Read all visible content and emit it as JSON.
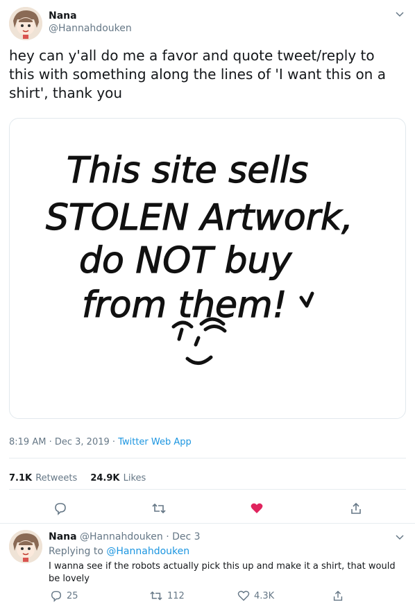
{
  "main_tweet": {
    "author_name": "Nana",
    "author_handle": "@Hannahdouken",
    "text": "hey can y'all do me a favor and quote tweet/reply to this with something along the lines of 'I want this on a shirt', thank you",
    "image_text": [
      "This site sells",
      "STOLEN Artwork,",
      "do NOT buy",
      "from them!"
    ],
    "time": "8:19 AM",
    "sep1": "·",
    "date": "Dec 3, 2019",
    "sep2": "·",
    "source": "Twitter Web App",
    "retweets_count": "7.1K",
    "retweets_label": "Retweets",
    "likes_count": "24.9K",
    "likes_label": "Likes"
  },
  "reply": {
    "author_name": "Nana",
    "author_handle": "@Hannahdouken",
    "sep": "·",
    "date": "Dec 3",
    "replying_label": "Replying to",
    "replying_to": "@Hannahdouken",
    "text": "I wanna see if the robots actually pick this up and make it a shirt, that would be lovely",
    "reply_count": "25",
    "retweet_count": "112",
    "like_count": "4.3K"
  },
  "colors": {
    "accent": "#1b95e0",
    "like": "#e0245e",
    "muted": "#657786"
  }
}
